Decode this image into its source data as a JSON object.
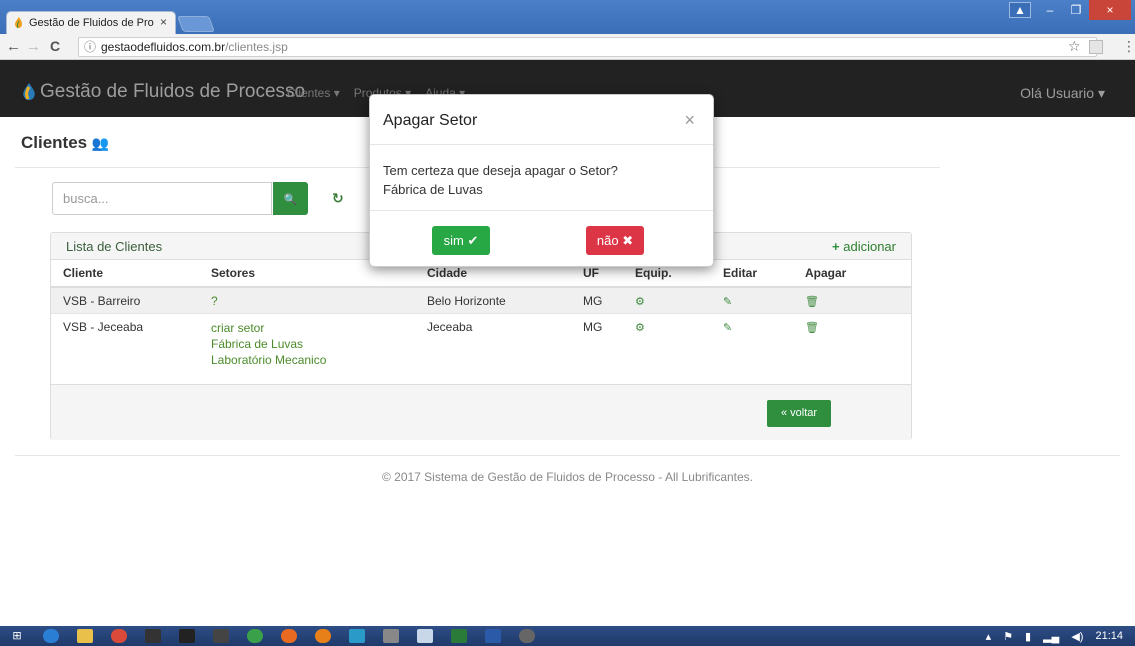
{
  "browser": {
    "tab_title": "Gestão de Fluidos de Pro",
    "tab_close": "×",
    "url_host": "gestaodefluidos.com.br",
    "url_path": "/clientes.jsp",
    "back": "←",
    "forward": "→",
    "reload": "C",
    "info": "ⓘ",
    "star": "☆",
    "menu": "⋮"
  },
  "window": {
    "minimize": "–",
    "restore": "❐",
    "close": "×",
    "user": "▲"
  },
  "navbar": {
    "brand": "Gestão de Fluidos de Processo",
    "menu": [
      "Clientes ▾",
      "Produtos ▾",
      "Ajuda ▾"
    ],
    "user": "Olá Usuario ▾"
  },
  "page": {
    "title": "Clientes",
    "title_icon": "👥",
    "search_placeholder": "busca...",
    "search_icon": "🔍",
    "refresh_icon": "↻"
  },
  "panel": {
    "title": "Lista de Clientes",
    "add_icon": "+",
    "add_label": "adicionar",
    "columns": [
      "Cliente",
      "Setores",
      "Cidade",
      "UF",
      "Equip.",
      "Editar",
      "Apagar"
    ],
    "rows": [
      {
        "cliente": "VSB - Barreiro",
        "setores": [
          "?"
        ],
        "cidade": "Belo Horizonte",
        "uf": "MG",
        "equip": "⚙",
        "editar": "✎",
        "apagar": "🗑"
      },
      {
        "cliente": "VSB - Jeceaba",
        "setores": [
          "criar setor",
          "Fábrica de Luvas",
          "Laboratório Mecanico"
        ],
        "cidade": "Jeceaba",
        "uf": "MG",
        "equip": "⚙",
        "editar": "✎",
        "apagar": "🗑"
      }
    ],
    "voltar": "« voltar"
  },
  "footer": "© 2017 Sistema de Gestão de Fluidos de Processo - All Lubrificantes.",
  "modal": {
    "title": "Apagar Setor",
    "close": "×",
    "question": "Tem certeza que deseja apagar o Setor?",
    "sector": "Fábrica de Luvas",
    "yes": "sim ✔",
    "no": "não ✖"
  },
  "taskbar": {
    "clock": "21:14"
  }
}
